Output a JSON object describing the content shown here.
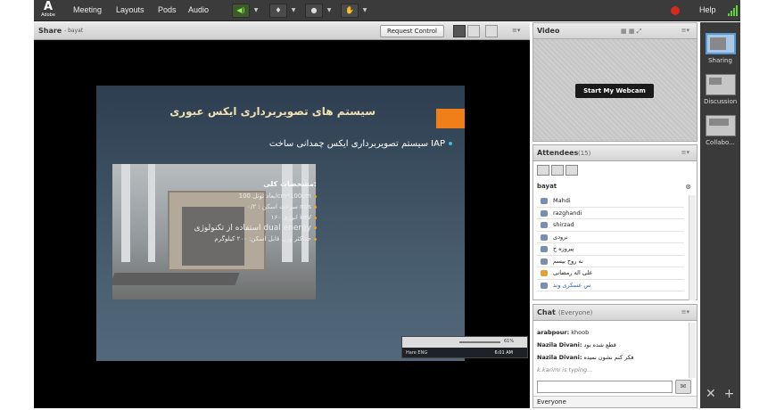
{
  "menubar": {
    "logo_main": "A",
    "logo_sub": "Adobe",
    "items": [
      "Meeting",
      "Layouts",
      "Pods",
      "Audio"
    ],
    "help": "Help"
  },
  "share": {
    "title": "Share",
    "subtitle": "- bayat",
    "request_control": "Request Control",
    "slide": {
      "title": "سیستم های تصویربرداری ایکس عبوری",
      "bullet": "سیستم تصویربرداری ایکس چمدانی ساخت IAP",
      "specs_heading": "مشخصات کلی:",
      "specs": [
        "ابعاد تونل 100cm*100cm",
        "سرعت اسکن : ۰/۲ m/s",
        "انرژی ۱۶۰ keV",
        "استفاده از تکنولوژی dual energy",
        "حداکثر وزن قابل اسکن: ۲۰۰ کیلوگرم"
      ]
    },
    "taskbar": {
      "zoom": "61%",
      "tray_text": "Hare  ENG",
      "clock": "6:01 AM"
    }
  },
  "video": {
    "title": "Video",
    "start_webcam": "Start My Webcam"
  },
  "attendees": {
    "title": "Attendees",
    "count": "(15)",
    "host": "bayat",
    "list": [
      {
        "name": "Mahdi",
        "style": "normal"
      },
      {
        "name": "razghandi",
        "style": "normal"
      },
      {
        "name": "shirzad",
        "style": "normal"
      },
      {
        "name": "نرودی",
        "style": "normal"
      },
      {
        "name": "پیروزه ح",
        "style": "normal"
      },
      {
        "name": "نه روح بیسم",
        "style": "normal"
      },
      {
        "name": "علی اله رمضانی",
        "style": "orange"
      },
      {
        "name": "س عسکری وند",
        "style": "blue"
      }
    ]
  },
  "chat": {
    "title": "Chat",
    "scope": "(Everyone)",
    "messages": [
      {
        "from": "arabpour:",
        "text": "khoob"
      },
      {
        "from": "Nazila Divani:",
        "text": "قطع شده بود"
      },
      {
        "from": "Nazila Divani:",
        "text": "فکر کنم نشون نمیده"
      }
    ],
    "typing": "k.karimi is typing...",
    "input_value": "",
    "recipient": "Everyone"
  },
  "layouts": {
    "items": [
      "Sharing",
      "Discussion",
      "Collabo..."
    ]
  },
  "colors": {
    "accent": "#f07f1a",
    "menubar": "#3b3b3b",
    "record": "#d42a1f"
  }
}
